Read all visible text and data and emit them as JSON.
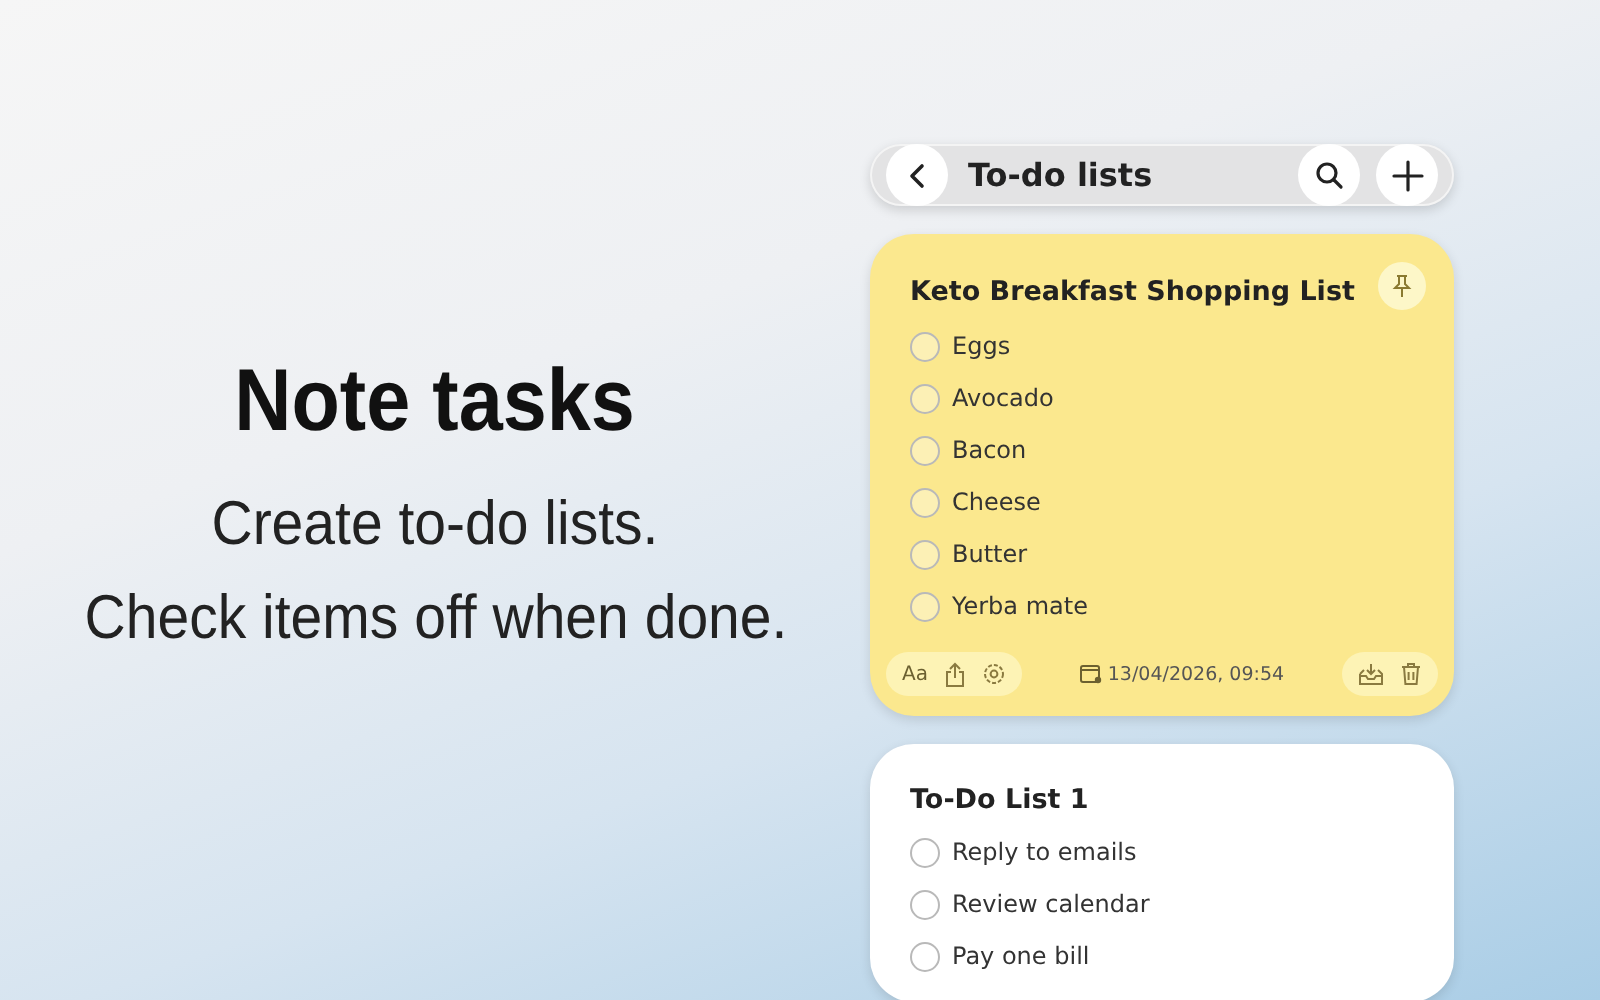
{
  "promo": {
    "title": "Note tasks",
    "lines": [
      "Create to-do lists.",
      "Check items off when done."
    ]
  },
  "header": {
    "title": "To-do lists"
  },
  "notes": [
    {
      "title": "Keto Breakfast Shopping List",
      "color": "#fbe88e",
      "pinned": true,
      "items": [
        {
          "label": "Eggs",
          "checked": false
        },
        {
          "label": "Avocado",
          "checked": false
        },
        {
          "label": "Bacon",
          "checked": false
        },
        {
          "label": "Cheese",
          "checked": false
        },
        {
          "label": "Butter",
          "checked": false
        },
        {
          "label": "Yerba mate",
          "checked": false
        }
      ],
      "footer": {
        "font_button": "Aa",
        "date": "13/04/2026, 09:54"
      }
    },
    {
      "title": "To-Do List 1",
      "color": "#ffffff",
      "pinned": false,
      "items": [
        {
          "label": "Reply to emails",
          "checked": false
        },
        {
          "label": "Review calendar",
          "checked": false
        },
        {
          "label": "Pay one bill",
          "checked": false
        }
      ]
    }
  ]
}
